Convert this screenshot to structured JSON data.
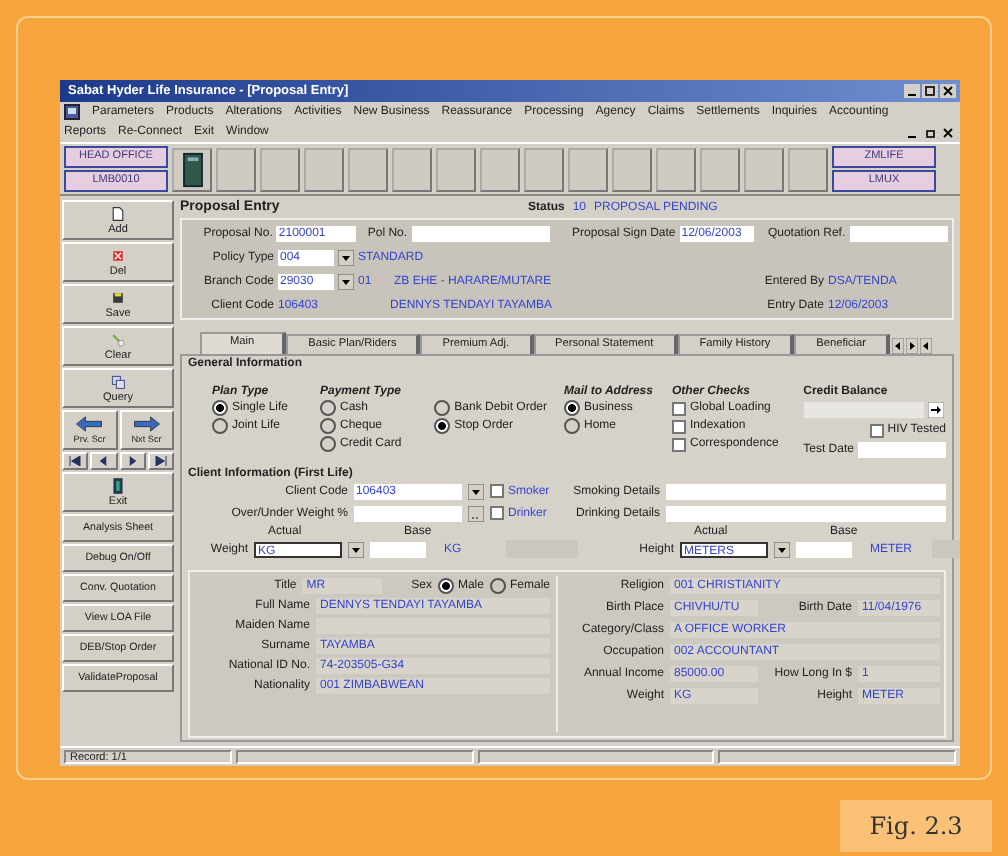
{
  "window": {
    "title": "Sabat Hyder Life Insurance - [Proposal Entry]"
  },
  "menu_rows": [
    [
      "Parameters",
      "Products",
      "Alterations",
      "Activities",
      "New Business",
      "Reassurance",
      "Processing",
      "Agency",
      "Claims",
      "Settlements",
      "Inquiries",
      "Accounting"
    ],
    [
      "Reports",
      "Re-Connect",
      "Exit",
      "Window"
    ]
  ],
  "toolbar": {
    "left": [
      "HEAD OFFICE",
      "LMB0010"
    ],
    "right": [
      "ZMLIFE",
      "LMUX"
    ]
  },
  "sidebar": [
    {
      "kind": "icon",
      "label": "Add"
    },
    {
      "kind": "icon",
      "label": "Del"
    },
    {
      "kind": "icon",
      "label": "Save"
    },
    {
      "kind": "icon",
      "label": "Clear"
    },
    {
      "kind": "icon",
      "label": "Query"
    },
    {
      "kind": "arrows",
      "labels": [
        "Prv. Scr",
        "Nxt Scr"
      ]
    },
    {
      "kind": "nav"
    },
    {
      "kind": "icon",
      "label": "Exit"
    },
    {
      "kind": "text",
      "label": "Analysis Sheet"
    },
    {
      "kind": "text",
      "label": "Debug On/Off"
    },
    {
      "kind": "text",
      "label": "Conv. Quotation"
    },
    {
      "kind": "text",
      "label": "View LOA File"
    },
    {
      "kind": "text",
      "label": "DEB/Stop Order"
    },
    {
      "kind": "text",
      "label": "ValidateProposal"
    }
  ],
  "form": {
    "title": "Proposal Entry",
    "status": {
      "label": "Status",
      "code": "10",
      "text": "PROPOSAL PENDING"
    },
    "proposal_no": {
      "label": "Proposal No.",
      "value": "2100001"
    },
    "pol_no": {
      "label": "Pol No."
    },
    "sign_date": {
      "label": "Proposal Sign Date",
      "value": "12/06/2003"
    },
    "quotation_ref": {
      "label": "Quotation Ref."
    },
    "policy_type": {
      "label": "Policy Type",
      "code": "004",
      "text": "STANDARD"
    },
    "branch_code": {
      "label": "Branch Code",
      "code": "29030",
      "sub": "01",
      "text": "ZB EHE - HARARE/MUTARE"
    },
    "client_code": {
      "label": "Client Code",
      "code": "106403",
      "text": "DENNYS TENDAYI TAYAMBA"
    },
    "entered_by": {
      "label": "Entered By",
      "value": "DSA/TENDA"
    },
    "entry_date": {
      "label": "Entry Date",
      "value": "12/06/2003"
    }
  },
  "tabs": [
    {
      "label": "Main",
      "selected": true
    },
    {
      "label": "Basic Plan/Riders",
      "selected": false
    },
    {
      "label": "Premium Adj.",
      "selected": false
    },
    {
      "label": "Personal Statement",
      "selected": false
    },
    {
      "label": "Family History",
      "selected": false
    },
    {
      "label": "Beneficiar",
      "selected": false
    }
  ],
  "general": {
    "title": "General Information",
    "groups": [
      {
        "title": "Plan Type",
        "kind": "radio",
        "items": [
          {
            "label": "Single Life",
            "selected": true
          },
          {
            "label": "Joint Life",
            "selected": false
          }
        ]
      },
      {
        "title": "Payment Type",
        "kind": "radio",
        "items": [
          {
            "label": "Cash",
            "selected": false
          },
          {
            "label": "Cheque",
            "selected": false
          },
          {
            "label": "Credit Card",
            "selected": false
          },
          {
            "label": "Bank Debit Order",
            "selected": false
          },
          {
            "label": "Stop Order",
            "selected": true
          }
        ]
      },
      {
        "title": "Mail to Address",
        "kind": "radio",
        "items": [
          {
            "label": "Business",
            "selected": true
          },
          {
            "label": "Home",
            "selected": false
          }
        ]
      },
      {
        "title": "Other Checks",
        "kind": "check",
        "items": [
          {
            "label": "Global Loading",
            "checked": false
          },
          {
            "label": "Indexation",
            "checked": false
          },
          {
            "label": "Correspondence",
            "checked": false
          }
        ]
      }
    ],
    "credit_balance": {
      "label": "Credit Balance"
    },
    "hiv_tested": {
      "label": "HIV Tested",
      "checked": false
    },
    "test_date": {
      "label": "Test Date"
    }
  },
  "client": {
    "title": "Client Information (First Life)",
    "client_code": {
      "label": "Client Code",
      "value": "106403"
    },
    "over_under_weight": {
      "label": "Over/Under Weight %"
    },
    "smoker": {
      "label": "Smoker",
      "checked": false
    },
    "drinker": {
      "label": "Drinker",
      "checked": false
    },
    "smoking_details": {
      "label": "Smoking Details"
    },
    "drinking_details": {
      "label": "Drinking Details"
    },
    "measures": [
      {
        "label": "Weight",
        "actual_label": "Actual",
        "base_label": "Base",
        "unit": "KG",
        "base": "KG"
      },
      {
        "label": "Height",
        "actual_label": "Actual",
        "base_label": "Base",
        "unit": "METERS",
        "base": "METER"
      }
    ]
  },
  "personal": {
    "title": {
      "label": "Title",
      "value": "MR"
    },
    "sex": {
      "label": "Sex",
      "options": [
        {
          "label": "Male",
          "selected": true
        },
        {
          "label": "Female",
          "selected": false
        }
      ]
    },
    "left": [
      {
        "label": "Full Name",
        "value": "DENNYS TENDAYI TAYAMBA"
      },
      {
        "label": "Maiden Name"
      },
      {
        "label": "Surname",
        "value": "TAYAMBA"
      },
      {
        "label": "National ID No.",
        "value": "74-203505-G34"
      },
      {
        "label": "Nationality",
        "value": "001   ZIMBABWEAN"
      }
    ],
    "right": [
      [
        {
          "label": "Religion",
          "value": "001   CHRISTIANITY"
        }
      ],
      [
        {
          "label": "Birth Place",
          "value": "CHIVHU/TU"
        },
        {
          "label": "Birth Date",
          "value": "11/04/1976"
        }
      ],
      [
        {
          "label": "Category/Class",
          "value": "A     OFFICE WORKER"
        }
      ],
      [
        {
          "label": "Occupation",
          "value": "002   ACCOUNTANT"
        }
      ],
      [
        {
          "label": "Annual Income",
          "value": "85000.00"
        },
        {
          "label": "How Long In $",
          "value": "1"
        }
      ],
      [
        {
          "label": "Weight",
          "value": "KG"
        },
        {
          "label": "Height",
          "value": "METER"
        }
      ]
    ]
  },
  "status_bar": {
    "text": "Record: 1/1"
  },
  "caption": "Fig. 2.3"
}
